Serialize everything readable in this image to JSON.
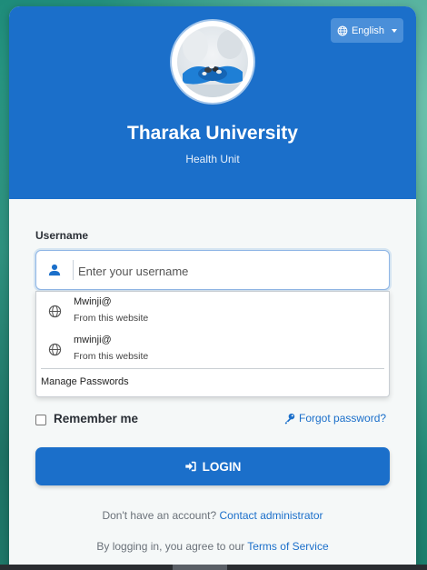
{
  "header": {
    "title": "Tharaka University",
    "subtitle": "Health Unit",
    "language_label": "English",
    "icons": {
      "language": "globe-icon",
      "caret": "caret-down-icon",
      "avatar": "avatar-image"
    }
  },
  "form": {
    "username_label": "Username",
    "username_placeholder": "Enter your username",
    "username_value": "",
    "icons": {
      "user": "user-icon"
    }
  },
  "autofill": {
    "items": [
      {
        "name": "Mwinji@",
        "source": "From this website"
      },
      {
        "name": "mwinji@",
        "source": "From this website"
      }
    ],
    "manage_label": "Manage Passwords"
  },
  "options": {
    "remember_label": "Remember me",
    "remember_checked": false,
    "forgot_label": "Forgot password?"
  },
  "login": {
    "label": "LOGIN"
  },
  "footer": {
    "noaccount_text": "Don't have an account?",
    "contact_link": "Contact administrator",
    "terms_text": "By logging in, you agree to our",
    "terms_link": "Terms of Service"
  },
  "colors": {
    "primary": "#1b6fca",
    "header_bg": "#1b6fca",
    "background": "#2f9a86"
  }
}
